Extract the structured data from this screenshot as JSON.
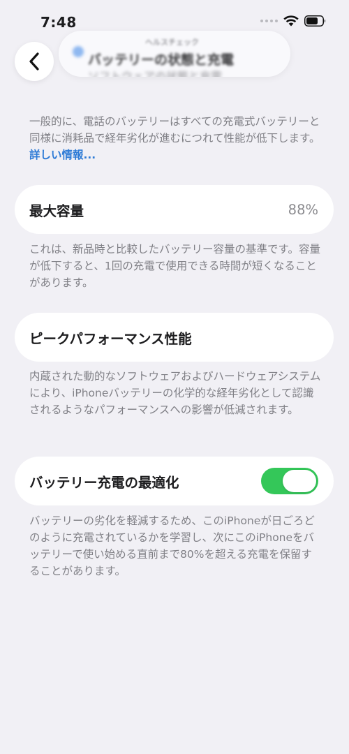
{
  "status_bar": {
    "time": "7:48",
    "icons": [
      "signal-dots-icon",
      "wifi-icon",
      "battery-icon"
    ]
  },
  "nav": {
    "back_icon": "chevron-left-icon",
    "title_subtitle": "ヘルスチェック",
    "title": "バッテリーの状態と充電"
  },
  "intro": {
    "text": "一般的に、電話のバッテリーはすべての充電式バッテリーと同様に消耗品で経年劣化が進むにつれて性能が低下します。",
    "link": "詳しい情報..."
  },
  "max_capacity": {
    "label": "最大容量",
    "value": "88%",
    "description": "これは、新品時と比較したバッテリー容量の基準です。容量が低下すると、1回の充電で使用できる時間が短くなることがあります。"
  },
  "peak_performance": {
    "label": "ピークパフォーマンス性能",
    "description": "内蔵された動的なソフトウェアおよびハードウェアシステムにより、iPhoneバッテリーの化学的な経年劣化として認識されるようなパフォーマンスへの影響が低減されます。"
  },
  "optimized_charging": {
    "label": "バッテリー充電の最適化",
    "enabled": true,
    "description": "バッテリーの劣化を軽減するため、このiPhoneが日ごろどのように充電されているかを学習し、次にこのiPhoneをバッテリーで使い始める直前まで80%を超える充電を保留することがあります。"
  },
  "colors": {
    "background": "#f1f0f5",
    "card": "#ffffff",
    "link": "#2e7bd6",
    "toggle_on": "#34c759",
    "secondary_text": "#808086"
  }
}
